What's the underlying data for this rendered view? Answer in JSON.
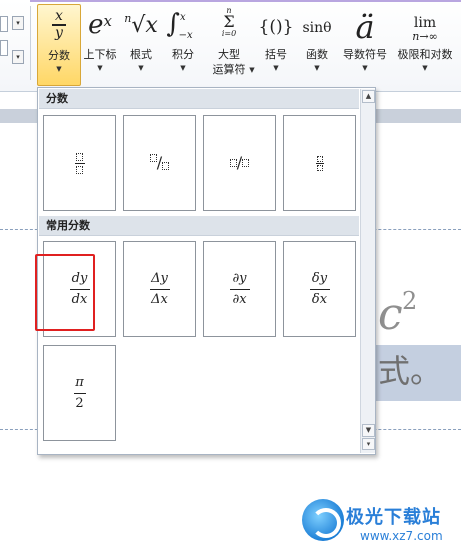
{
  "ribbon": {
    "buttons": [
      {
        "id": "fraction",
        "label": "分数",
        "active": true,
        "icon": "fraction-x-over-y-icon",
        "num": "x",
        "den": "y"
      },
      {
        "id": "script",
        "label": "上下标",
        "icon": "superscript-icon",
        "base": "e",
        "sup": "x"
      },
      {
        "id": "radical",
        "label": "根式",
        "icon": "radical-icon",
        "idx": "n",
        "rad": "√x"
      },
      {
        "id": "integral",
        "label": "积分",
        "icon": "integral-icon",
        "sym": "∫",
        "up": "x",
        "lo": "−x"
      },
      {
        "id": "large-operator",
        "label": "大型",
        "label2": "运算符",
        "icon": "summation-icon",
        "top": "n",
        "sym": "Σ",
        "bot": "i=0"
      },
      {
        "id": "bracket",
        "label": "括号",
        "icon": "bracket-icon",
        "sym": "{()}"
      },
      {
        "id": "function",
        "label": "函数",
        "icon": "function-icon",
        "sym": "sinθ"
      },
      {
        "id": "accent",
        "label": "导数符号",
        "icon": "accent-icon",
        "sym": "ä"
      },
      {
        "id": "limit-log",
        "label": "极限和对数",
        "icon": "limit-icon",
        "sym": "lim",
        "sub": "n→∞"
      }
    ]
  },
  "gallery": {
    "section1": {
      "title": "分数"
    },
    "section2": {
      "title": "常用分数"
    },
    "common": [
      {
        "num": "dy",
        "den": "dx"
      },
      {
        "num": "Δy",
        "den": "Δx"
      },
      {
        "num": "∂y",
        "den": "∂x"
      },
      {
        "num": "δy",
        "den": "δx"
      },
      {
        "num": "π",
        "den": "2"
      }
    ]
  },
  "document": {
    "char_c": "c",
    "char_sup": "2",
    "char_shi": "式。"
  },
  "watermark": {
    "name": "极光下载站",
    "url": "www.xz7.com"
  }
}
